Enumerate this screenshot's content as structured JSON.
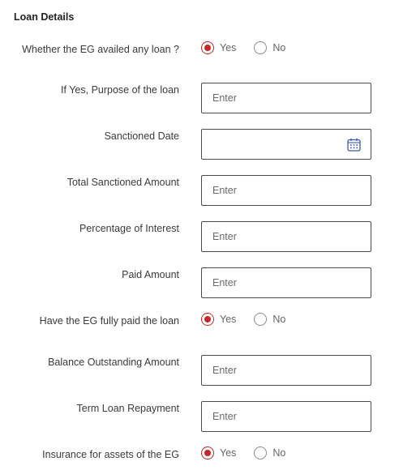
{
  "section": {
    "title": "Loan Details"
  },
  "questions": {
    "loan_availed": {
      "label": "Whether the EG availed any loan ?",
      "options": [
        "Yes",
        "No"
      ],
      "selected": "Yes"
    },
    "purpose": {
      "label": "If Yes, Purpose of the loan",
      "placeholder": "Enter"
    },
    "sanctioned_date": {
      "label": "Sanctioned Date",
      "icon": "calendar-icon"
    },
    "total_sanctioned": {
      "label": "Total Sanctioned Amount",
      "placeholder": "Enter"
    },
    "interest": {
      "label": "Percentage of Interest",
      "placeholder": "Enter"
    },
    "paid_amount": {
      "label": "Paid Amount",
      "placeholder": "Enter"
    },
    "fully_paid": {
      "label": "Have the EG fully paid the loan",
      "options": [
        "Yes",
        "No"
      ],
      "selected": "Yes"
    },
    "balance": {
      "label": "Balance Outstanding Amount",
      "placeholder": "Enter"
    },
    "term_loan": {
      "label": "Term Loan Repayment",
      "placeholder": "Enter"
    },
    "insurance": {
      "label": "Insurance for assets of the EG",
      "options": [
        "Yes",
        "No"
      ],
      "selected": "Yes"
    }
  },
  "colors": {
    "accent": "#c62828",
    "border": "#4a4a4a"
  }
}
